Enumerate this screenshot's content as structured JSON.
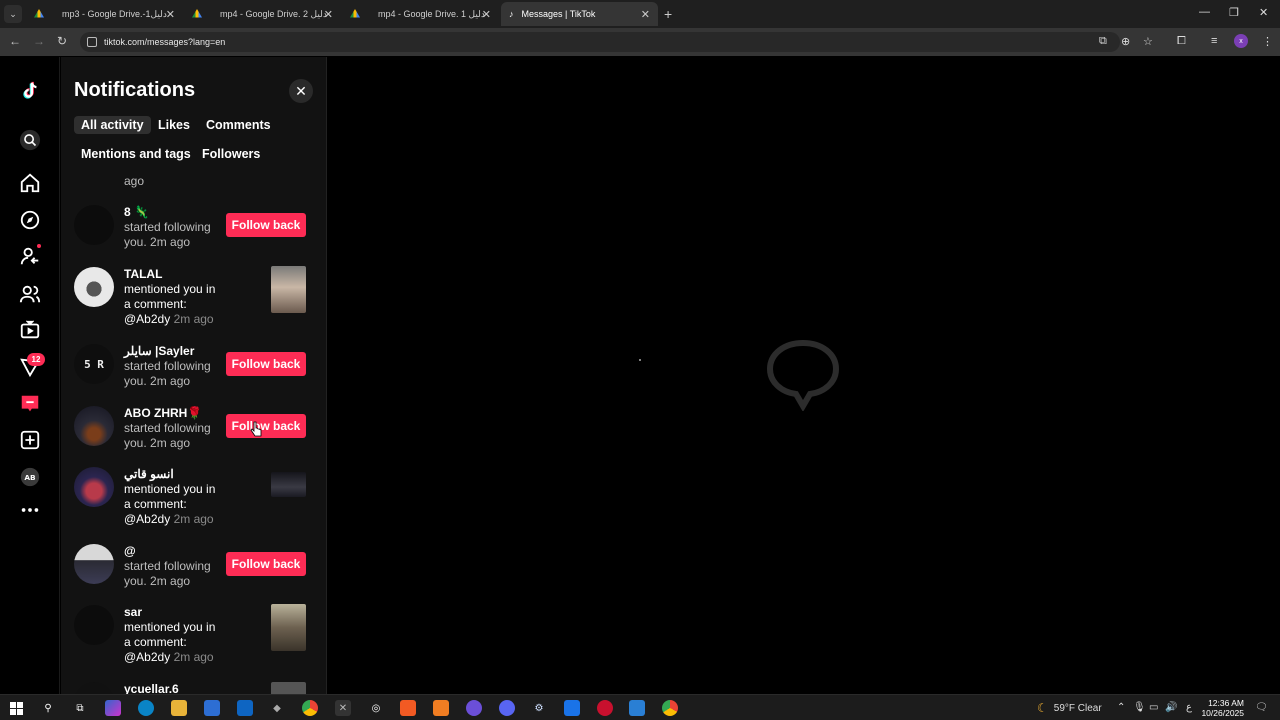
{
  "browser": {
    "tabs": [
      {
        "title": "mp3 - Google Drive.-1دليل",
        "active": false
      },
      {
        "title": "mp4 - Google Drive. 2 دليل",
        "active": false
      },
      {
        "title": "mp4 - Google Drive. 1 دليل",
        "active": false
      },
      {
        "title": "Messages | TikTok",
        "active": true
      }
    ],
    "url": "tiktok.com/messages?lang=en",
    "profile_initial": "x"
  },
  "sidebar": {
    "inbox_badge": "12"
  },
  "notifications": {
    "title": "Notifications",
    "filters": [
      "All activity",
      "Likes",
      "Comments",
      "Mentions and tags",
      "Followers"
    ],
    "active_filter": "All activity",
    "partial_top_text": "ago",
    "items": [
      {
        "name": "8 🦎",
        "desc": "started following you. 2m ago",
        "action": "Follow back",
        "type": "follow"
      },
      {
        "name": "TALAL",
        "desc_main": "mentioned you in a comment: @Ab2dy",
        "time": "2m ago",
        "type": "mention"
      },
      {
        "name": "سايلر |Sayler",
        "desc": "started following you. 2m ago",
        "action": "Follow back",
        "type": "follow"
      },
      {
        "name": "ABO ZHRH🌹",
        "desc": "started following you. 2m ago",
        "action": "Follow back",
        "type": "follow"
      },
      {
        "name": "انسو قاتي",
        "desc_main": "mentioned you in a comment: @Ab2dy",
        "time": "2m ago",
        "type": "mention"
      },
      {
        "name": "@",
        "desc": "started following you. 2m ago",
        "action": "Follow back",
        "type": "follow"
      },
      {
        "name": "sar",
        "desc_main": "mentioned you in a comment: @Ab2dy",
        "time": "2m ago",
        "type": "mention"
      },
      {
        "name": "ycuellar.6",
        "type": "mention"
      }
    ]
  },
  "taskbar": {
    "weather": "59°F  Clear",
    "time": "12:36 AM",
    "date": "10/26/2025",
    "lang": "ع"
  },
  "colors": {
    "accent": "#fe2c55",
    "background": "#000000",
    "panel": "#121212"
  }
}
